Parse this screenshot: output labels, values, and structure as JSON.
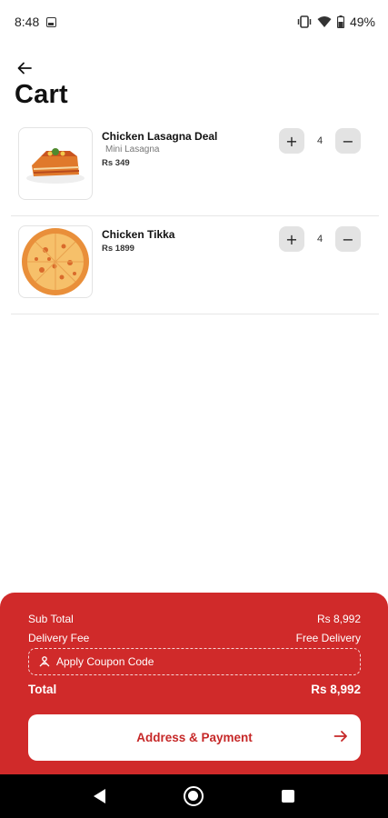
{
  "status_bar": {
    "time": "8:48",
    "battery": "49%",
    "icons": [
      "image-icon",
      "vibrate-icon",
      "wifi-icon",
      "battery-icon"
    ]
  },
  "header": {
    "back_icon": "arrow-left-icon",
    "title": "Cart"
  },
  "cart": {
    "items": [
      {
        "name": "Chicken Lasagna Deal",
        "variant": "Mini Lasagna",
        "price": "Rs 349",
        "quantity": "4",
        "image": "lasagna-image"
      },
      {
        "name": "Chicken Tikka",
        "variant": "",
        "price": "Rs 1899",
        "quantity": "4",
        "image": "pizza-image"
      }
    ],
    "increase_symbol": "+",
    "decrease_symbol": "−"
  },
  "summary": {
    "subtotal_label": "Sub Total",
    "subtotal_value": "Rs 8,992",
    "delivery_label": "Delivery Fee",
    "delivery_value": "Free Delivery",
    "coupon_label": "Apply Coupon Code",
    "total_label": "Total",
    "total_value": "Rs 8,992",
    "cta_label": "Address & Payment"
  },
  "colors": {
    "accent": "#d02a2a",
    "cta_text": "#c62828",
    "qty_button_bg": "#e3e3e3"
  }
}
